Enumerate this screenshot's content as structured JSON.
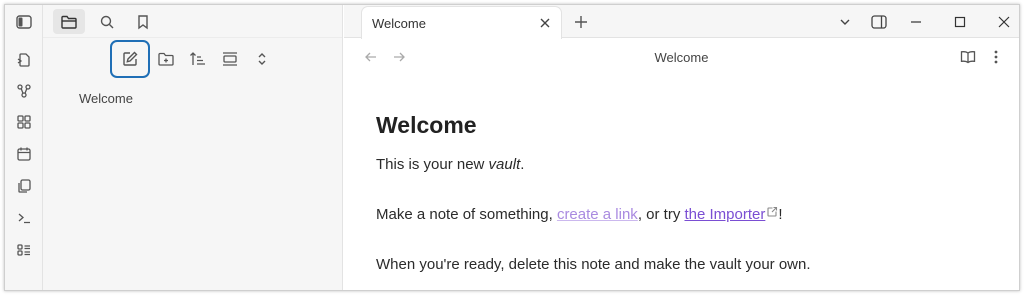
{
  "sidebar": {
    "file_tree": [
      {
        "label": "Welcome"
      }
    ]
  },
  "tabs": [
    {
      "title": "Welcome"
    }
  ],
  "view": {
    "title": "Welcome"
  },
  "note": {
    "heading": "Welcome",
    "line1": {
      "text": "This is your new ",
      "emphasis": "vault",
      "end": "."
    },
    "line2": {
      "text": "Make a note of something, ",
      "link": "create a link",
      "middle": ", or try ",
      "external_link": "the Importer",
      "end": "!"
    },
    "line3": "When you're ready, delete this note and make the vault your own."
  },
  "colors": {
    "accent_focus": "#1f6fb6",
    "internal_link": "#a98ae0",
    "external_link": "#7a4ed3"
  },
  "icons": {
    "ribbon": [
      "sidebar-toggle-icon",
      "switcher-icon",
      "graph-icon",
      "canvas-icon",
      "calendar-icon",
      "templates-icon",
      "command-palette-icon",
      "bases-icon"
    ],
    "sidebar_tabs": [
      "folder-icon",
      "search-icon",
      "bookmark-icon"
    ],
    "sidebar_nav": [
      "new-note-icon",
      "new-folder-icon",
      "sort-icon",
      "collapse-all-icon",
      "expand-icon"
    ]
  }
}
